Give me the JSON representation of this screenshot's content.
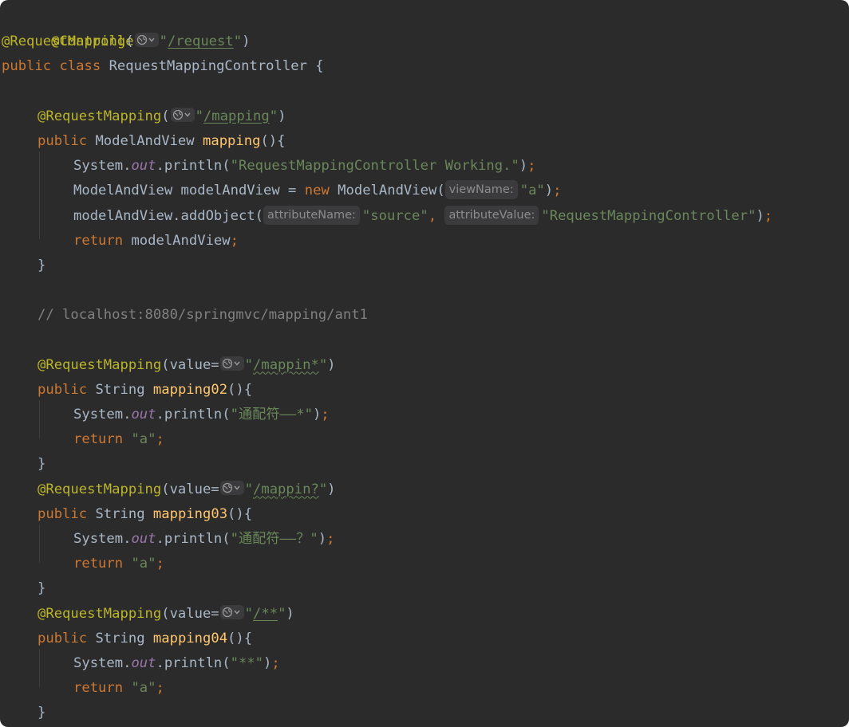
{
  "colors": {
    "background": "#2b2b2c",
    "keyword": "#cc7832",
    "annotation": "#bbb529",
    "string": "#6a8759",
    "method": "#ffc66d",
    "field": "#9876aa",
    "comment": "#808080",
    "text": "#a9b7c6"
  },
  "code": {
    "l1": {
      "ann": "@Controller"
    },
    "l2": {
      "ann": "@RequestMapping",
      "open": "(",
      "q1": "\"",
      "path": "/request",
      "q2": "\"",
      "close": ")"
    },
    "l3": {
      "kw1": "public",
      "kw2": "class",
      "name": "RequestMappingController",
      "brace": "{"
    },
    "l5": {
      "ann": "@RequestMapping",
      "open": "(",
      "q1": "\"",
      "path": "/mapping",
      "q2": "\"",
      "close": ")"
    },
    "l6": {
      "kw": "public",
      "type": "ModelAndView",
      "fn": "mapping",
      "rest": "(){"
    },
    "l7": {
      "a": "System.",
      "field": "out",
      "b": ".println(",
      "str": "\"RequestMappingController Working.\"",
      "c": ")",
      "semi": ";"
    },
    "l8": {
      "a": "ModelAndView modelAndView = ",
      "kw": "new",
      "b": " ModelAndView(",
      "hint": "viewName:",
      "str": "\"a\"",
      "c": ")",
      "semi": ";"
    },
    "l9": {
      "a": "modelAndView.addObject(",
      "hint1": "attributeName:",
      "str1": "\"source\"",
      "comma": ",",
      "hint2": "attributeValue:",
      "str2": "\"RequestMappingController\"",
      "c": ")",
      "semi": ";"
    },
    "l10": {
      "kw": "return",
      "a": " modelAndView",
      "semi": ";"
    },
    "l11": {
      "brace": "}"
    },
    "l13": {
      "cmt": "// localhost:8080/springmvc/mapping/ant1"
    },
    "l15": {
      "ann": "@RequestMapping",
      "open": "(value=",
      "q1": "\"",
      "path": "/mappin*",
      "q2": "\"",
      "close": ")"
    },
    "l16": {
      "kw": "public",
      "type": "String",
      "fn": "mapping02",
      "rest": "(){"
    },
    "l17": {
      "a": "System.",
      "field": "out",
      "b": ".println(",
      "str": "\"通配符——*\"",
      "c": ")",
      "semi": ";"
    },
    "l18": {
      "kw": "return",
      "str": "\"a\"",
      "semi": ";"
    },
    "l19": {
      "brace": "}"
    },
    "l20": {
      "ann": "@RequestMapping",
      "open": "(value=",
      "q1": "\"",
      "path": "/mappin?",
      "q2": "\"",
      "close": ")"
    },
    "l21": {
      "kw": "public",
      "type": "String",
      "fn": "mapping03",
      "rest": "(){"
    },
    "l22": {
      "a": "System.",
      "field": "out",
      "b": ".println(",
      "str": "\"通配符——？\"",
      "c": ")",
      "semi": ";"
    },
    "l23": {
      "kw": "return",
      "str": "\"a\"",
      "semi": ";"
    },
    "l24": {
      "brace": "}"
    },
    "l25": {
      "ann": "@RequestMapping",
      "open": "(value=",
      "q1": "\"",
      "path": "/**",
      "q2": "\"",
      "close": ")"
    },
    "l26": {
      "kw": "public",
      "type": "String",
      "fn": "mapping04",
      "rest": "(){"
    },
    "l27": {
      "a": "System.",
      "field": "out",
      "b": ".println(",
      "str": "\"**\"",
      "c": ")",
      "semi": ";"
    },
    "l28": {
      "kw": "return",
      "str": "\"a\"",
      "semi": ";"
    },
    "l29": {
      "brace": "}"
    }
  },
  "icons": {
    "url_icon": "globe-dropdown-icon"
  }
}
